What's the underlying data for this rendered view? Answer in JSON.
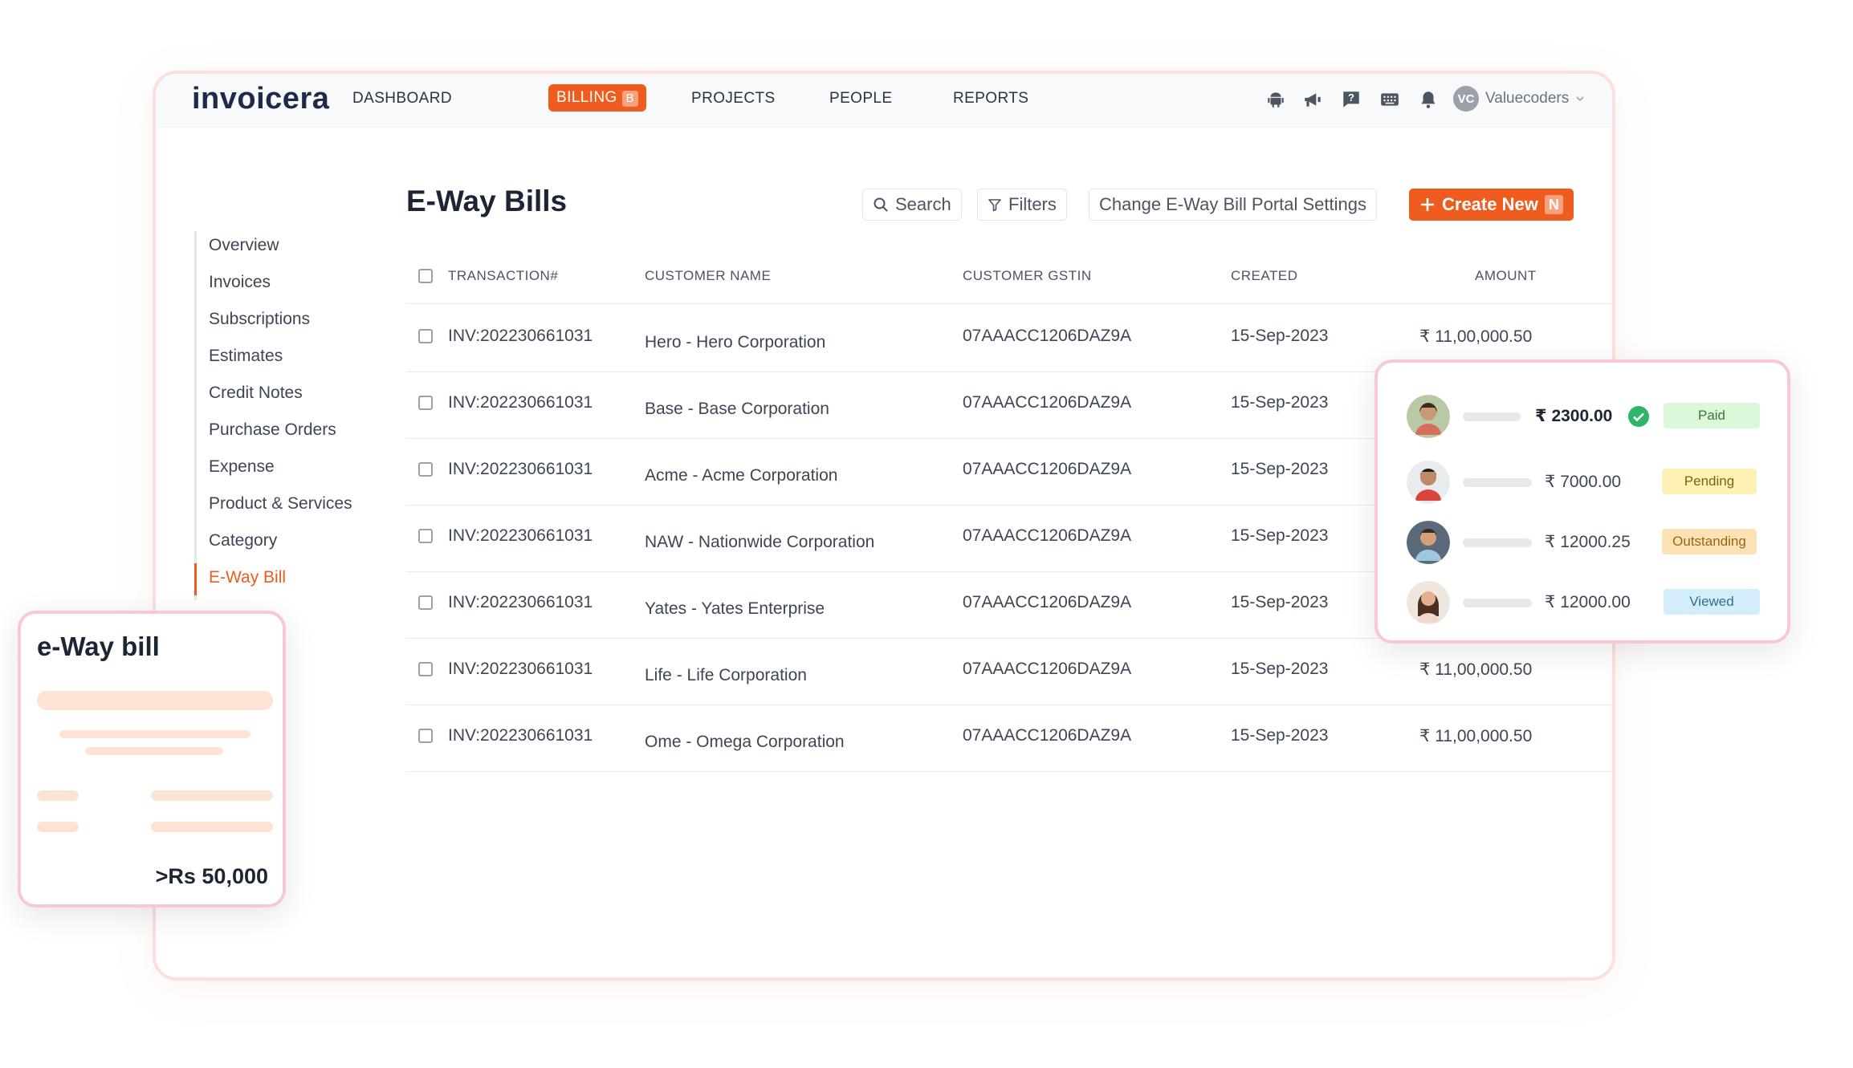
{
  "app": {
    "logo_text": "invoicera"
  },
  "nav": {
    "items": [
      {
        "label": "DASHBOARD"
      },
      {
        "label": "BILLING",
        "badge": "B",
        "active": true
      },
      {
        "label": "PROJECTS"
      },
      {
        "label": "PEOPLE"
      },
      {
        "label": "REPORTS"
      }
    ],
    "icons": [
      "android-icon",
      "megaphone-icon",
      "help-icon",
      "keyboard-icon",
      "bell-icon"
    ],
    "user": {
      "initials": "VC",
      "name": "Valuecoders"
    }
  },
  "sidebar": {
    "items": [
      {
        "label": "Overview"
      },
      {
        "label": "Invoices"
      },
      {
        "label": "Subscriptions"
      },
      {
        "label": "Estimates"
      },
      {
        "label": "Credit Notes"
      },
      {
        "label": "Purchase Orders"
      },
      {
        "label": "Expense"
      },
      {
        "label": "Product & Services"
      },
      {
        "label": "Category"
      },
      {
        "label": "E-Way Bill",
        "active": true
      }
    ]
  },
  "page": {
    "title": "E-Way Bills",
    "search_label": "Search",
    "filters_label": "Filters",
    "settings_label": "Change E-Way Bill Portal Settings",
    "create_label": "Create New",
    "create_badge": "N"
  },
  "table": {
    "columns": [
      "TRANSACTION#",
      "CUSTOMER NAME",
      "CUSTOMER GSTIN",
      "CREATED",
      "AMOUNT"
    ],
    "rows": [
      {
        "txn": "INV:202230661031",
        "customer": "Hero - Hero Corporation",
        "gstin": "07AAACC1206DAZ9A",
        "created": "15-Sep-2023",
        "amount": "₹ 11,00,000.50"
      },
      {
        "txn": "INV:202230661031",
        "customer": "Base - Base Corporation",
        "gstin": "07AAACC1206DAZ9A",
        "created": "15-Sep-2023",
        "amount": ""
      },
      {
        "txn": "INV:202230661031",
        "customer": "Acme - Acme Corporation",
        "gstin": "07AAACC1206DAZ9A",
        "created": "15-Sep-2023",
        "amount": ""
      },
      {
        "txn": "INV:202230661031",
        "customer": "NAW - Nationwide Corporation",
        "gstin": "07AAACC1206DAZ9A",
        "created": "15-Sep-2023",
        "amount": ""
      },
      {
        "txn": "INV:202230661031",
        "customer": "Yates - Yates Enterprise",
        "gstin": "07AAACC1206DAZ9A",
        "created": "15-Sep-2023",
        "amount": ""
      },
      {
        "txn": "INV:202230661031",
        "customer": "Life - Life Corporation",
        "gstin": "07AAACC1206DAZ9A",
        "created": "15-Sep-2023",
        "amount": "₹ 11,00,000.50"
      },
      {
        "txn": "INV:202230661031",
        "customer": "Ome - Omega Corporation",
        "gstin": "07AAACC1206DAZ9A",
        "created": "15-Sep-2023",
        "amount": "₹ 11,00,000.50"
      }
    ]
  },
  "status_card": {
    "rows": [
      {
        "amount": "₹ 2300.00",
        "status": "Paid",
        "bg": "#dcf7d9",
        "fg": "#3b7a35",
        "checked": true
      },
      {
        "amount": "₹ 7000.00",
        "status": "Pending",
        "bg": "#fdf2b3",
        "fg": "#7a6410"
      },
      {
        "amount": "₹ 12000.25",
        "status": "Outstanding",
        "bg": "#fde2b5",
        "fg": "#9a6512"
      },
      {
        "amount": "₹ 12000.00",
        "status": "Viewed",
        "bg": "#d3eefa",
        "fg": "#2f6f8e"
      }
    ]
  },
  "eway_card": {
    "title": "e-Way bill",
    "amount": ">Rs 50,000"
  },
  "colors": {
    "accent": "#ee5c1f",
    "card_border": "#f8c9d4",
    "window_border": "#fbe0dc"
  }
}
